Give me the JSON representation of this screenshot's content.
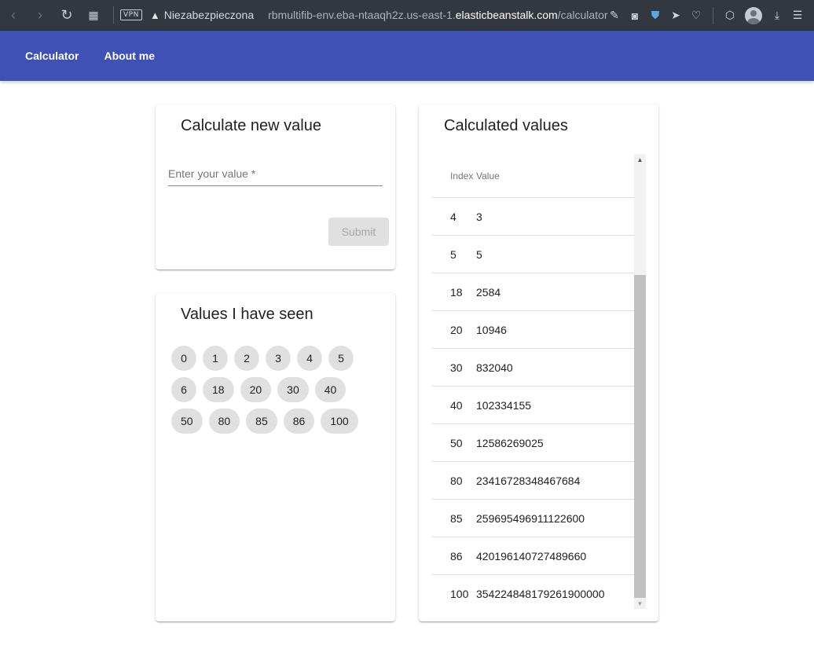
{
  "browser": {
    "back_icon": "‹",
    "forward_icon": "›",
    "reload_icon": "↻",
    "tabs_icon": "▦",
    "vpn_label": "VPN",
    "security_warning": "Niezabezpieczona",
    "url_prefix": "rbmultifib-env.eba-ntaaqh2z.us-east-1.",
    "url_domain": "elasticbeanstalk.com",
    "url_path": "/calculator"
  },
  "nav": {
    "calculator": "Calculator",
    "about": "About me"
  },
  "calculate_card": {
    "title": "Calculate new value",
    "input_placeholder": "Enter your value *",
    "submit_label": "Submit"
  },
  "seen_card": {
    "title": "Values I have seen",
    "rows": [
      [
        "0",
        "1",
        "2",
        "3",
        "4",
        "5"
      ],
      [
        "6",
        "18",
        "20",
        "30",
        "40"
      ],
      [
        "50",
        "80",
        "85",
        "86",
        "100"
      ]
    ]
  },
  "values_card": {
    "title": "Calculated values",
    "columns": [
      "Index",
      "Value"
    ],
    "rows": [
      [
        "4",
        "3"
      ],
      [
        "5",
        "5"
      ],
      [
        "18",
        "2584"
      ],
      [
        "20",
        "10946"
      ],
      [
        "30",
        "832040"
      ],
      [
        "40",
        "102334155"
      ],
      [
        "50",
        "12586269025"
      ],
      [
        "80",
        "23416728348467684"
      ],
      [
        "85",
        "259695496911122600"
      ],
      [
        "86",
        "420196140727489660"
      ],
      [
        "100",
        "354224848179261900000"
      ]
    ]
  }
}
